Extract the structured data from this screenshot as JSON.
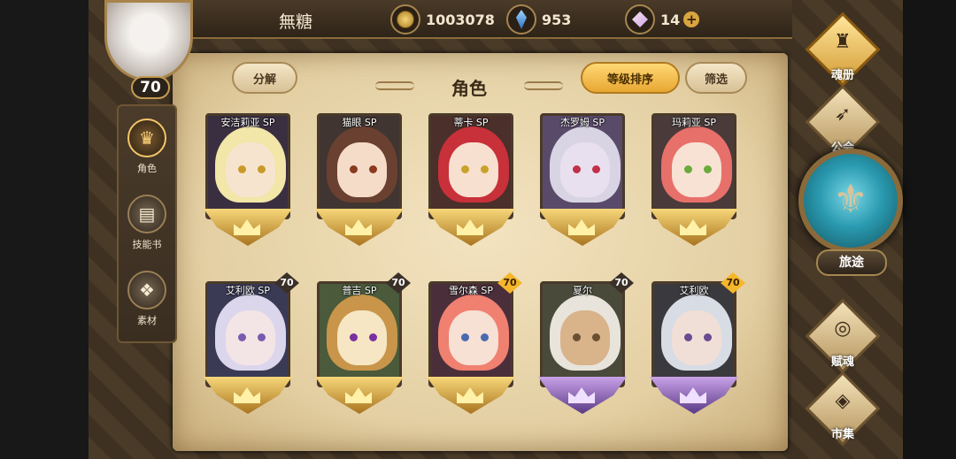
{
  "player": {
    "name": "無糖",
    "level": "70"
  },
  "currencies": {
    "gold": "1003078",
    "crystal": "953",
    "gem": "14"
  },
  "header": {
    "title": "角色",
    "decompose_label": "分解",
    "sort_label": "等级排序",
    "filter_label": "筛选"
  },
  "left_nav": [
    {
      "label": "角色",
      "icon": "character-icon",
      "active": true
    },
    {
      "label": "技能书",
      "icon": "skill-book-icon",
      "active": false
    },
    {
      "label": "素材",
      "icon": "material-icon",
      "active": false
    }
  ],
  "right_nav": [
    {
      "label": "魂册",
      "icon": "soul-book-icon",
      "active": true
    },
    {
      "label": "公会",
      "icon": "guild-icon",
      "active": false
    },
    {
      "label": "赋魂",
      "icon": "soul-imbue-icon",
      "active": false
    },
    {
      "label": "市集",
      "icon": "market-icon",
      "active": false
    }
  ],
  "journey": {
    "label": "旅途",
    "icon": "journey-icon"
  },
  "characters": [
    {
      "name": "安洁莉亚 SP",
      "level": "",
      "hair": "#f2e6a8",
      "skin": "#f7e4cf",
      "eye": "#c99a2a",
      "bg": "#3a2f40",
      "tier": "gold"
    },
    {
      "name": "猫眼 SP",
      "level": "",
      "hair": "#6a4030",
      "skin": "#f4dcc8",
      "eye": "#8a3a20",
      "bg": "#403530",
      "tier": "gold"
    },
    {
      "name": "蒂卡 SP",
      "level": "",
      "hair": "#c8303a",
      "skin": "#f7e0cf",
      "eye": "#c9a22a",
      "bg": "#4a2f2a",
      "tier": "gold"
    },
    {
      "name": "杰罗姆 SP",
      "level": "",
      "hair": "#d8d4e4",
      "skin": "#e8e0ee",
      "eye": "#c03048",
      "bg": "#5a4a6a",
      "tier": "gold"
    },
    {
      "name": "玛莉亚 SP",
      "level": "",
      "hair": "#e8706a",
      "skin": "#f7e2d4",
      "eye": "#6aaa3a",
      "bg": "#4a3a3a",
      "tier": "gold"
    },
    {
      "name": "艾利欧 SP",
      "level": "70",
      "hair": "#dcd6ec",
      "skin": "#f3e4e6",
      "eye": "#7a5ab0",
      "bg": "#3a3a55",
      "tier": "gold",
      "lv_style": "dark"
    },
    {
      "name": "普吉 SP",
      "level": "70",
      "hair": "#c8954a",
      "skin": "#f6e6c4",
      "eye": "#7a30a0",
      "bg": "#4a5a3a",
      "tier": "gold",
      "lv_style": "dark"
    },
    {
      "name": "雪尔森 SP",
      "level": "70",
      "hair": "#f08070",
      "skin": "#f7e0d4",
      "eye": "#4a6ab0",
      "bg": "#4a2f3a",
      "tier": "gold",
      "lv_style": "gold"
    },
    {
      "name": "夏尔",
      "level": "70",
      "hair": "#e8e4dc",
      "skin": "#d9b38a",
      "eye": "#6a5030",
      "bg": "#4a4a3a",
      "tier": "purple",
      "lv_style": "dark"
    },
    {
      "name": "艾利欧",
      "level": "70",
      "hair": "#d8dce4",
      "skin": "#f0dfd6",
      "eye": "#6a4a90",
      "bg": "#3a3a3e",
      "tier": "purple",
      "lv_style": "gold"
    }
  ]
}
